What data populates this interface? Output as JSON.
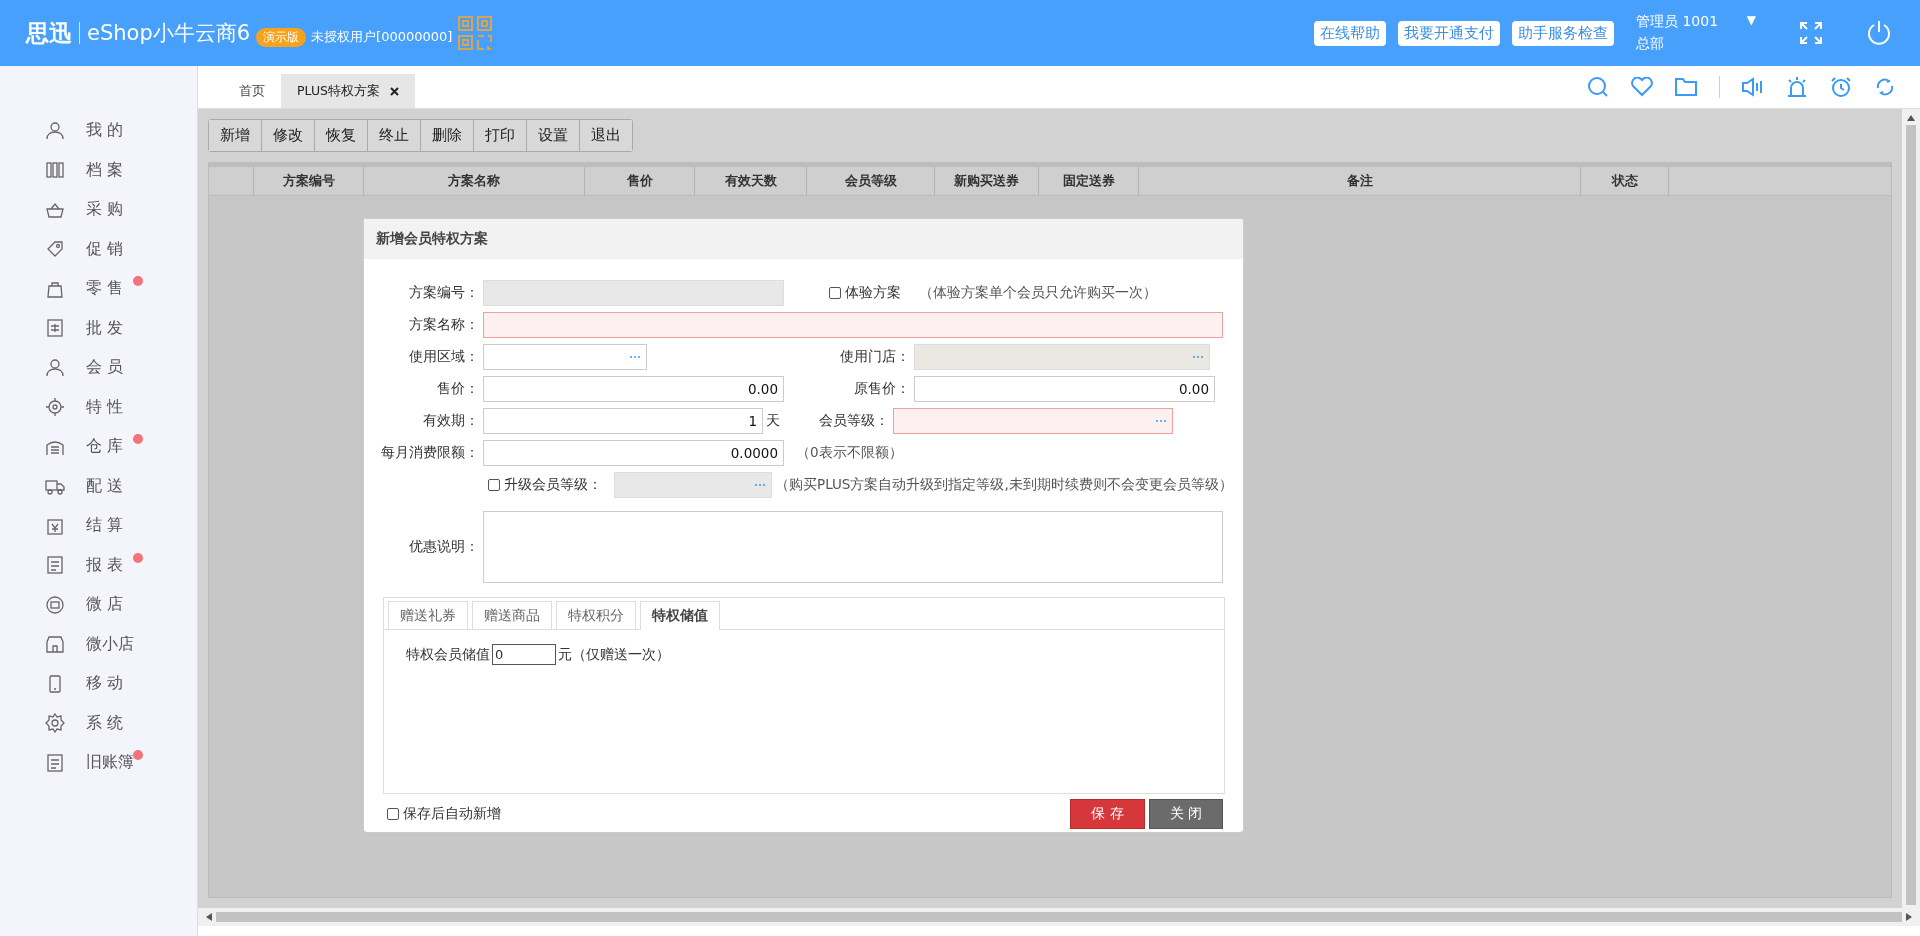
{
  "header": {
    "brand": "思迅",
    "product": "eShop小牛云商6",
    "edition": "演示版",
    "license": "未授权用户[00000000]",
    "buttons": [
      "在线帮助",
      "我要开通支付",
      "助手服务检查"
    ],
    "user": "管理员 1001",
    "dropdown": "▼",
    "branch": "总部"
  },
  "sidebar": {
    "items": [
      {
        "label": "我 的",
        "badge": false
      },
      {
        "label": "档 案",
        "badge": false
      },
      {
        "label": "采 购",
        "badge": false
      },
      {
        "label": "促 销",
        "badge": false
      },
      {
        "label": "零 售",
        "badge": true
      },
      {
        "label": "批 发",
        "badge": false
      },
      {
        "label": "会 员",
        "badge": false
      },
      {
        "label": "特 性",
        "badge": false
      },
      {
        "label": "仓 库",
        "badge": true
      },
      {
        "label": "配 送",
        "badge": false
      },
      {
        "label": "结 算",
        "badge": false
      },
      {
        "label": "报 表",
        "badge": true
      },
      {
        "label": "微 店",
        "badge": false
      },
      {
        "label": "微小店",
        "badge": false
      },
      {
        "label": "移 动",
        "badge": false
      },
      {
        "label": "系 统",
        "badge": false
      },
      {
        "label": "旧账簿",
        "badge": true
      }
    ]
  },
  "tabs": [
    {
      "label": "首页",
      "selected": false,
      "closable": false
    },
    {
      "label": "PLUS特权方案",
      "selected": true,
      "closable": true
    }
  ],
  "toolbar": [
    "新增",
    "修改",
    "恢复",
    "终止",
    "删除",
    "打印",
    "设置",
    "退出"
  ],
  "table": {
    "columns": [
      "方案编号",
      "方案名称",
      "售价",
      "有效天数",
      "会员等级",
      "新购买送券",
      "固定送券",
      "备注",
      "状态"
    ]
  },
  "dialog": {
    "title": "新增会员特权方案",
    "plan_no": {
      "label": "方案编号：",
      "disabled": true
    },
    "trial": {
      "label": "体验方案",
      "checked": false,
      "hint": "（体验方案单个会员只允许购买一次）"
    },
    "name": {
      "label": "方案名称：",
      "required": true
    },
    "area": {
      "label": "使用区域："
    },
    "store": {
      "label": "使用门店：",
      "disabled": true
    },
    "price": {
      "label": "售价：",
      "value": "0.00"
    },
    "original_price": {
      "label": "原售价：",
      "value": "0.00"
    },
    "validity": {
      "label": "有效期：",
      "value": "1",
      "unit": "天"
    },
    "member_level": {
      "label": "会员等级：",
      "required": true
    },
    "monthly_limit": {
      "label": "每月消费限额：",
      "value": "0.0000",
      "hint": "（0表示不限额）"
    },
    "upgrade": {
      "label": "升级会员等级：",
      "checked": false,
      "hint": "（购买PLUS方案自动升级到指定等级,未到期时续费则不会变更会员等级）"
    },
    "description": {
      "label": "优惠说明："
    },
    "tabs": [
      {
        "label": "赠送礼券",
        "selected": false
      },
      {
        "label": "赠送商品",
        "selected": false
      },
      {
        "label": "特权积分",
        "selected": false
      },
      {
        "label": "特权储值",
        "selected": true
      }
    ],
    "stored_value": {
      "label": "特权会员储值",
      "value": "0",
      "suffix": "元（仅赠送一次）"
    },
    "auto_new": {
      "label": "保存后自动新增",
      "checked": false
    },
    "buttons": [
      {
        "label": "保 存",
        "kind": "primary"
      },
      {
        "label": "关 闭",
        "kind": "secondary"
      }
    ]
  }
}
